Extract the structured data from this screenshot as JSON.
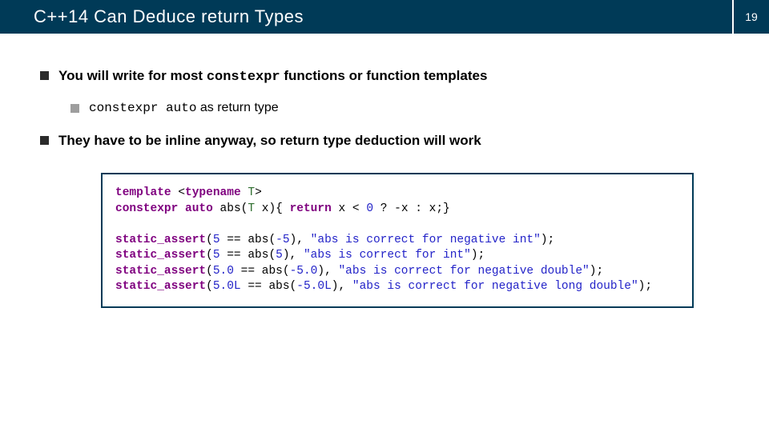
{
  "page_number": "19",
  "title": "C++14 Can Deduce return Types",
  "bullets": {
    "b1_pre": "You will write for most ",
    "b1_code": "constexpr",
    "b1_post": " functions or function templates",
    "b2_code": "constexpr auto",
    "b2_post": " as return type",
    "b3": "They have to be inline anyway, so return type deduction will work"
  },
  "code": {
    "l1a": "template",
    "l1b": " <",
    "l1c": "typename",
    "l1d": " ",
    "l1e": "T",
    "l1f": ">",
    "l2a": "constexpr",
    "l2b": " ",
    "l2c": "auto",
    "l2d": " abs(",
    "l2e": "T",
    "l2f": " x){ ",
    "l2g": "return",
    "l2h": " x < ",
    "l2i": "0",
    "l2j": " ? -x : x;}",
    "l4a": "static_assert",
    "l4b": "(",
    "l4c": "5",
    "l4d": " == abs(",
    "l4e": "-5",
    "l4f": "), ",
    "l4g": "\"abs is correct for negative int\"",
    "l4h": ");",
    "l5a": "static_assert",
    "l5b": "(",
    "l5c": "5",
    "l5d": " == abs(",
    "l5e": "5",
    "l5f": "), ",
    "l5g": "\"abs is correct for int\"",
    "l5h": ");",
    "l6a": "static_assert",
    "l6b": "(",
    "l6c": "5.0",
    "l6d": " == abs(",
    "l6e": "-5.0",
    "l6f": "), ",
    "l6g": "\"abs is correct for negative double\"",
    "l6h": ");",
    "l7a": "static_assert",
    "l7b": "(",
    "l7c": "5.0L",
    "l7d": " == abs(",
    "l7e": "-5.0L",
    "l7f": "), ",
    "l7g": "\"abs is correct for negative long double\"",
    "l7h": ");"
  }
}
